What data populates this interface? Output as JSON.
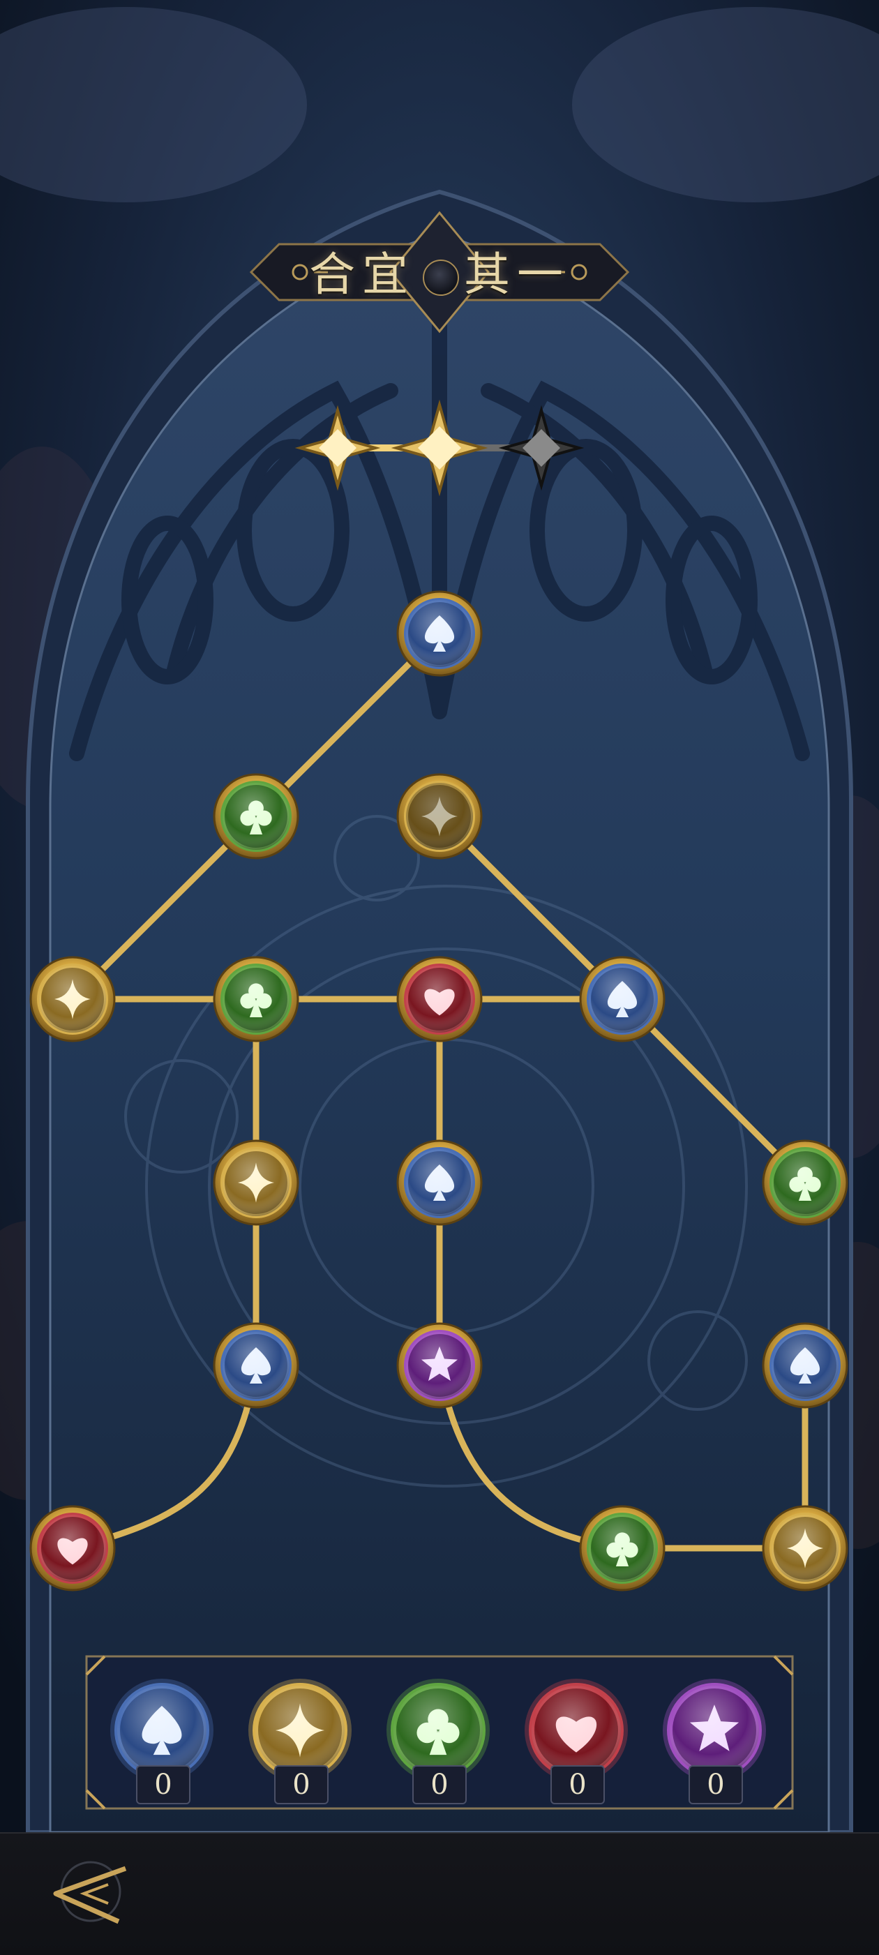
{
  "title": {
    "left": "合宜",
    "right": "其一"
  },
  "progress": {
    "stars_total": 3,
    "stars_achieved": 2
  },
  "suits": {
    "spade": {
      "name": "spade-icon",
      "ring": "#4a6fb5",
      "fill": "#2b4a86",
      "glyph": "#e6f0ff"
    },
    "diamond": {
      "name": "diamond-star-icon",
      "ring": "#d7b04d",
      "fill": "#8a6a22",
      "glyph": "#fff3c9"
    },
    "club": {
      "name": "club-icon",
      "ring": "#5fa540",
      "fill": "#2e6a1f",
      "glyph": "#e3ffd6"
    },
    "heart": {
      "name": "heart-icon",
      "ring": "#c2404a",
      "fill": "#7a1620",
      "glyph": "#ffd6dc"
    },
    "star": {
      "name": "star-icon",
      "ring": "#a04fc0",
      "fill": "#5e1e7a",
      "glyph": "#f2dcff"
    }
  },
  "nodes": [
    {
      "id": "n0",
      "suit": "spade",
      "node_state": "active"
    },
    {
      "id": "n1",
      "suit": "club",
      "node_state": "active"
    },
    {
      "id": "n2",
      "suit": "diamond",
      "node_state": "dim"
    },
    {
      "id": "n3",
      "suit": "diamond",
      "node_state": "active"
    },
    {
      "id": "n4",
      "suit": "club",
      "node_state": "active"
    },
    {
      "id": "n5",
      "suit": "heart",
      "node_state": "active"
    },
    {
      "id": "n6",
      "suit": "spade",
      "node_state": "active"
    },
    {
      "id": "n7",
      "suit": "diamond",
      "node_state": "active"
    },
    {
      "id": "n8",
      "suit": "spade",
      "node_state": "active"
    },
    {
      "id": "n9",
      "suit": "club",
      "node_state": "active"
    },
    {
      "id": "n10",
      "suit": "spade",
      "node_state": "active"
    },
    {
      "id": "n11",
      "suit": "star",
      "node_state": "active"
    },
    {
      "id": "n12",
      "suit": "spade",
      "node_state": "active"
    },
    {
      "id": "n13",
      "suit": "heart",
      "node_state": "active"
    },
    {
      "id": "n14",
      "suit": "club",
      "node_state": "active"
    },
    {
      "id": "n15",
      "suit": "diamond",
      "node_state": "active"
    }
  ],
  "edges": [
    [
      "n0",
      "n1"
    ],
    [
      "n1",
      "n3"
    ],
    [
      "n3",
      "n4"
    ],
    [
      "n4",
      "n5"
    ],
    [
      "n5",
      "n6"
    ],
    [
      "n2",
      "n6"
    ],
    [
      "n6",
      "n9"
    ],
    [
      "n4",
      "n7"
    ],
    [
      "n7",
      "n10"
    ],
    [
      "n10",
      "n13"
    ],
    [
      "n5",
      "n8"
    ],
    [
      "n8",
      "n11"
    ],
    [
      "n11",
      "n14"
    ],
    [
      "n14",
      "n15"
    ],
    [
      "n15",
      "n12"
    ]
  ],
  "inventory": [
    {
      "suit": "spade",
      "count": "0"
    },
    {
      "suit": "diamond",
      "count": "0"
    },
    {
      "suit": "club",
      "count": "0"
    },
    {
      "suit": "heart",
      "count": "0"
    },
    {
      "suit": "star",
      "count": "0"
    }
  ],
  "colors": {
    "line_gold": "#d9b45a",
    "frame_gold": "#c9a45a",
    "panel_bg": "#1a2640"
  }
}
